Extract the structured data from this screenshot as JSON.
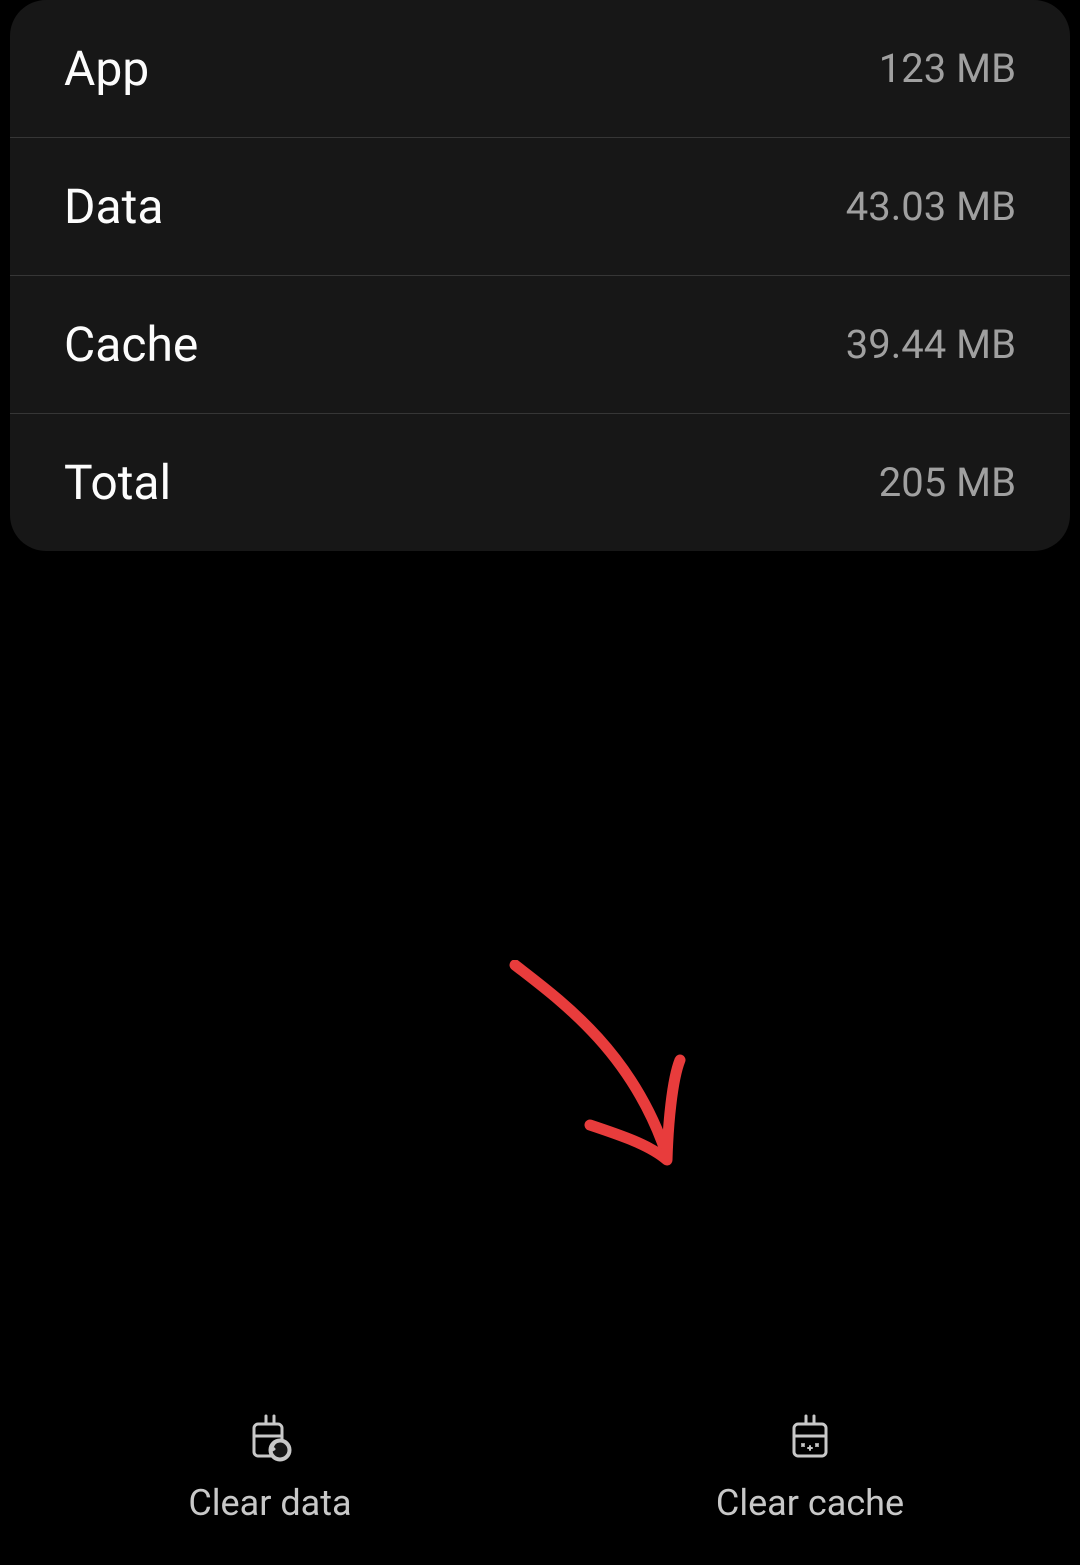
{
  "storage": {
    "rows": [
      {
        "label": "App",
        "value": "123 MB"
      },
      {
        "label": "Data",
        "value": "43.03 MB"
      },
      {
        "label": "Cache",
        "value": "39.44 MB"
      },
      {
        "label": "Total",
        "value": "205 MB"
      }
    ]
  },
  "actions": {
    "clear_data_label": "Clear data",
    "clear_cache_label": "Clear cache"
  },
  "annotation": {
    "arrow_color": "#e83c3c"
  }
}
